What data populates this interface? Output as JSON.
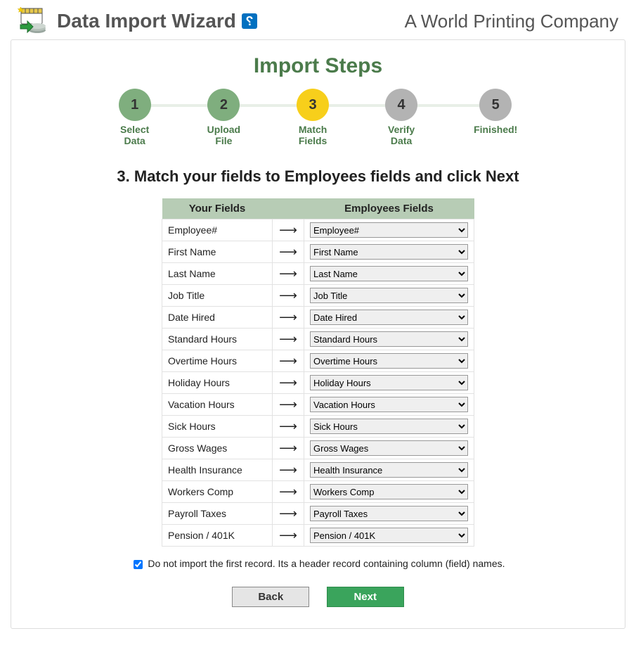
{
  "header": {
    "app_title": "Data Import Wizard",
    "help_glyph": "?",
    "company": "A World Printing Company"
  },
  "steps_title": "Import Steps",
  "steps": [
    {
      "num": "1",
      "label": "Select\nData",
      "state": "done"
    },
    {
      "num": "2",
      "label": "Upload\nFile",
      "state": "done"
    },
    {
      "num": "3",
      "label": "Match\nFields",
      "state": "current"
    },
    {
      "num": "4",
      "label": "Verify\nData",
      "state": "pending"
    },
    {
      "num": "5",
      "label": "Finished!",
      "state": "pending"
    }
  ],
  "section_title": "3. Match your fields to Employees fields and click Next",
  "table": {
    "col_your": "Your Fields",
    "col_target": "Employees Fields"
  },
  "fields": [
    {
      "your": "Employee#",
      "target": "Employee#"
    },
    {
      "your": "First Name",
      "target": "First Name"
    },
    {
      "your": "Last Name",
      "target": "Last Name"
    },
    {
      "your": "Job Title",
      "target": "Job Title"
    },
    {
      "your": "Date Hired",
      "target": "Date Hired"
    },
    {
      "your": "Standard Hours",
      "target": "Standard Hours"
    },
    {
      "your": "Overtime Hours",
      "target": "Overtime Hours"
    },
    {
      "your": "Holiday Hours",
      "target": "Holiday Hours"
    },
    {
      "your": "Vacation Hours",
      "target": "Vacation Hours"
    },
    {
      "your": "Sick Hours",
      "target": "Sick Hours"
    },
    {
      "your": "Gross Wages",
      "target": "Gross Wages"
    },
    {
      "your": "Health Insurance",
      "target": "Health Insurance"
    },
    {
      "your": "Workers Comp",
      "target": "Workers Comp"
    },
    {
      "your": "Payroll Taxes",
      "target": "Payroll Taxes"
    },
    {
      "your": "Pension / 401K",
      "target": "Pension / 401K"
    }
  ],
  "skip_first": {
    "checked": true,
    "label": "Do not import the first record. Its a header record containing column (field) names."
  },
  "buttons": {
    "back": "Back",
    "next": "Next"
  }
}
